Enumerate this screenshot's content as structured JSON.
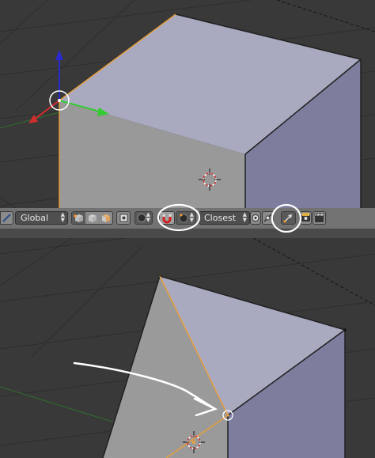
{
  "header": {
    "orientation_value": "Global",
    "snap_target_value": "Closest"
  },
  "colors": {
    "viewport_bg": "#393939",
    "header_bg": "#727272",
    "face_top": "#a9a9c0",
    "face_side": "#7d7d9e",
    "face_front": "#9a9a9a",
    "selection_edge": "#f0a030",
    "axis_x": "#d22d2d",
    "axis_y": "#33cc33",
    "axis_z": "#2a2ad0",
    "annotation": "#ffffff"
  },
  "icons": [
    "view-icon",
    "vertex-select-icon",
    "edge-select-icon",
    "face-select-icon",
    "occlude-geometry-icon",
    "proportional-edit-icon",
    "snap-magnet-icon",
    "snap-element-icon",
    "snap-self-icon",
    "snap-align-rotation-icon",
    "render-icon",
    "clapperboard-icon",
    "3d-cursor-icon",
    "manipulator-widget"
  ]
}
